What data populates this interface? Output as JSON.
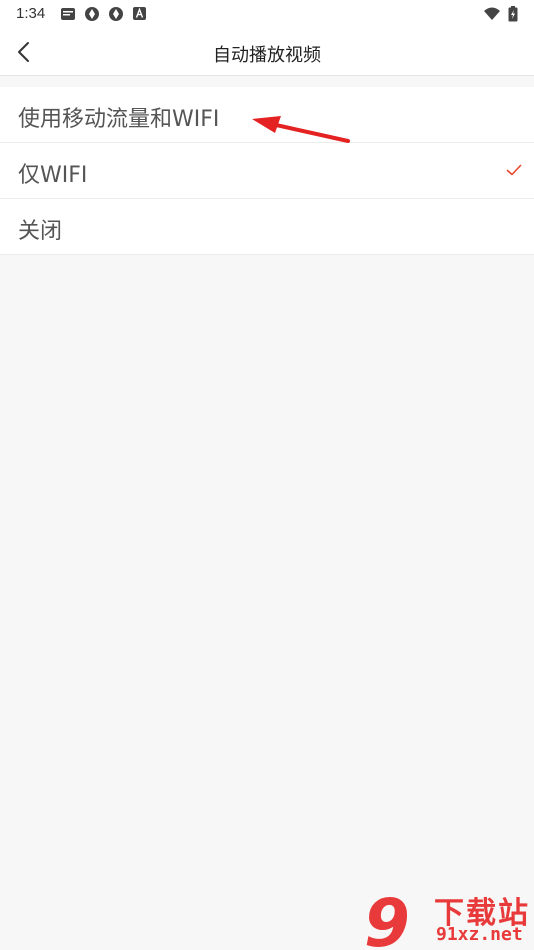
{
  "status_bar": {
    "time": "1:34",
    "icons": [
      "news-app-icon",
      "aperture-icon",
      "aperture-icon",
      "a-badge-icon",
      "wifi-icon",
      "battery-charging-icon"
    ]
  },
  "app_bar": {
    "title": "自动播放视频",
    "back_icon": "chevron-left-icon"
  },
  "options": [
    {
      "label": "使用移动流量和WIFI",
      "selected": false
    },
    {
      "label": "仅WIFI",
      "selected": true
    },
    {
      "label": "关闭",
      "selected": false
    }
  ],
  "colors": {
    "accent": "#e8472d",
    "annotation": "#e52222",
    "background": "#f7f7f7",
    "watermark": "#e83a3a"
  },
  "watermark": {
    "logo_text": "9",
    "title": "下载站",
    "url": "91xz.net"
  }
}
